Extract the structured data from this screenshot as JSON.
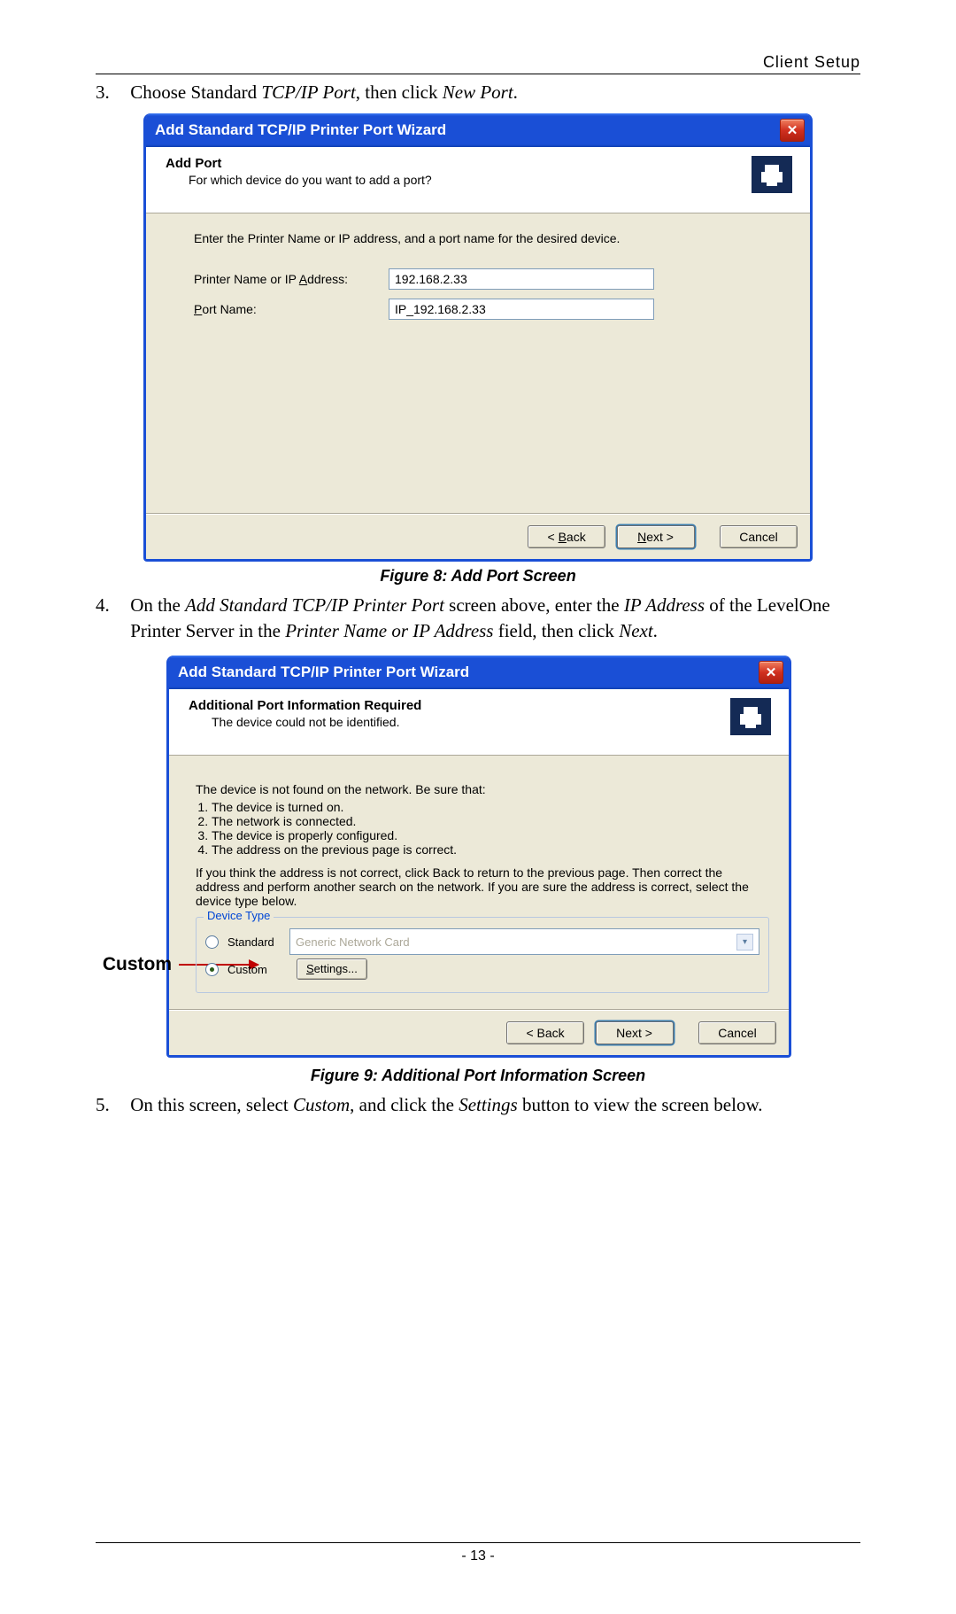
{
  "header_right": "Client Setup",
  "step3": {
    "num": "3.",
    "prefix": "Choose Standard ",
    "i1": "TCP/IP Port",
    "mid": ", then click ",
    "i2": "New Port",
    "suffix": "."
  },
  "dlg1": {
    "title": "Add Standard TCP/IP Printer Port Wizard",
    "header_title": "Add Port",
    "header_sub": "For which device do you want to add a port?",
    "intro": "Enter the Printer Name or IP address, and a port name for the desired device.",
    "label1_pre": "Printer Name or IP ",
    "label1_u": "A",
    "label1_post": "ddress:",
    "value1": "192.168.2.33",
    "label2_u": "P",
    "label2_post": "ort Name:",
    "value2": "IP_192.168.2.33",
    "back_u": "B",
    "back_post": "ack",
    "next_u": "N",
    "next_post": "ext >",
    "cancel": "Cancel"
  },
  "caption1": "Figure 8: Add Port Screen",
  "step4": {
    "num": "4.",
    "t1": "On the ",
    "i1": "Add Standard TCP/IP Printer Port",
    "t2": " screen above, enter the ",
    "i2": "IP Address",
    "t3": " of the LevelOne Printer Server in the ",
    "i3": "Printer Name or IP Address",
    "t4": " field, then click ",
    "i4": "Next",
    "t5": "."
  },
  "callout": "Custom",
  "dlg2": {
    "title": "Add Standard TCP/IP Printer Port Wizard",
    "header_title": "Additional Port Information Required",
    "header_sub": "The device could not be identified.",
    "p1": "The device is not found on the network.  Be sure that:",
    "li1": "The device is turned on.",
    "li2": "The network is connected.",
    "li3": "The device is properly configured.",
    "li4": "The address on the previous page is correct.",
    "p2": "If you think the address is not correct, click Back to return to the previous page.  Then correct the address and perform another search on the network.  If you are sure the address is correct, select the device type below.",
    "group_legend": "Device Type",
    "radio_standard": "Standard",
    "select_value": "Generic Network Card",
    "radio_custom": "Custom",
    "settings_u": "S",
    "settings_post": "ettings...",
    "back": "< Back",
    "next": "Next >",
    "cancel": "Cancel"
  },
  "caption2": "Figure 9: Additional Port Information Screen",
  "step5": {
    "num": "5.",
    "t1": "On this screen, select ",
    "i1": "Custom",
    "t2": ", and click the ",
    "i2": "Settings",
    "t3": " button to view the screen below."
  },
  "page_num": "- 13 -"
}
